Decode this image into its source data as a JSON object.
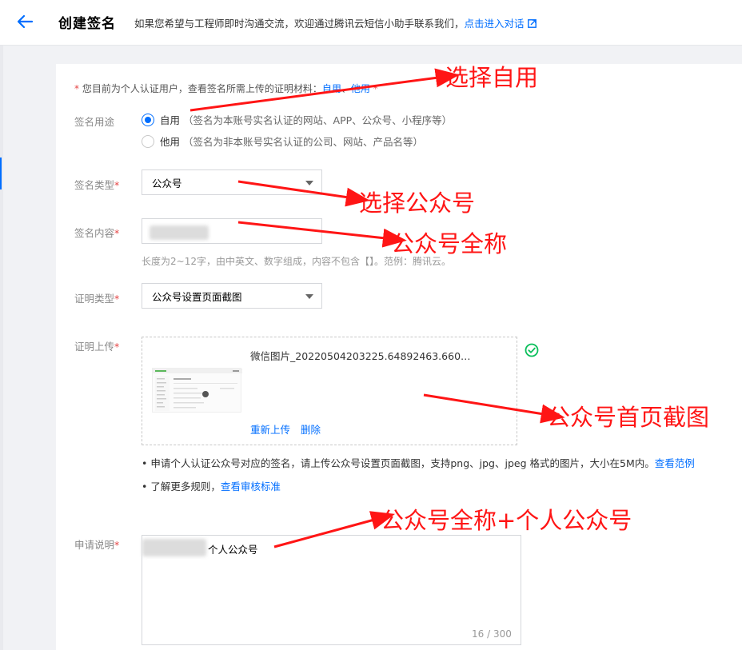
{
  "header": {
    "title": "创建签名",
    "tip_text": "如果您希望与工程师即时沟通交流，欢迎通过腾讯云短信小助手联系我们，",
    "tip_link": "点击进入对话"
  },
  "notice": {
    "star": "*",
    "text": " 您目前为个人认证用户，查看签名所需上传的证明材料：",
    "link_self": "自用",
    "sep": "、",
    "link_other": "他用",
    "tail_star": " *"
  },
  "form": {
    "purpose": {
      "label": "签名用途",
      "options": [
        {
          "label": "自用",
          "desc": "（签名为本账号实名认证的网站、APP、公众号、小程序等）",
          "checked": true
        },
        {
          "label": "他用",
          "desc": "（签名为非本账号实名认证的公司、网站、产品名等）",
          "checked": false
        }
      ]
    },
    "type": {
      "label": "签名类型",
      "req": "*",
      "value": "公众号"
    },
    "content": {
      "label": "签名内容",
      "req": "*",
      "hint": "长度为2~12字，由中英文、数字组成，内容不包含【】。范例：腾讯云。"
    },
    "proof_type": {
      "label": "证明类型",
      "req": "*",
      "value": "公众号设置页面截图"
    },
    "upload": {
      "label": "证明上传",
      "req": "*",
      "filename": "微信图片_20220504203225.64892463.660…",
      "reupload": "重新上传",
      "delete": "删除"
    },
    "bullets": [
      {
        "text": "申请个人认证公众号对应的签名，请上传公众号设置页面截图，支持png、jpg、jpeg 格式的图片，大小在5M内。",
        "link": "查看范例"
      },
      {
        "text": "了解更多规则，",
        "link": "查看审核标准"
      }
    ],
    "description": {
      "label": "申请说明",
      "req": "*",
      "value": "个人公众号",
      "counter": "16 / 300"
    }
  },
  "annotations": {
    "select_self": "选择自用",
    "select_account": "选择公众号",
    "account_fullname": "公众号全称",
    "home_screenshot": "公众号首页截图",
    "fullname_plus": "公众号全称+个人公众号"
  },
  "colors": {
    "accent": "#006eff",
    "annotation": "#ff1515",
    "required": "#e54545"
  }
}
